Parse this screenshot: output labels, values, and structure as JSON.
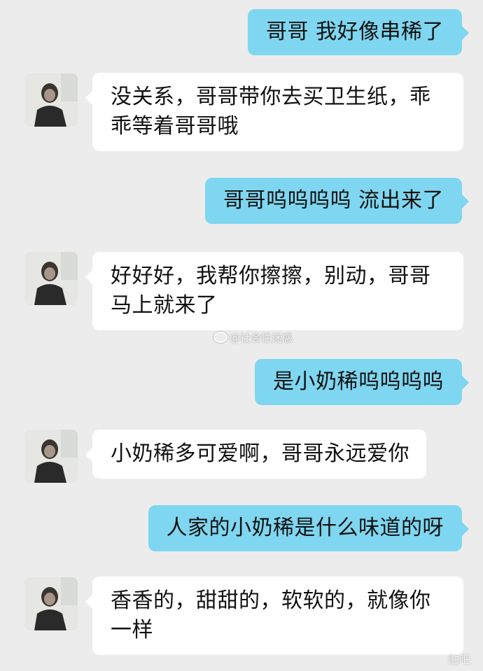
{
  "messages": [
    {
      "side": "sent",
      "text": "哥哥 我好像串稀了"
    },
    {
      "side": "received",
      "lines": [
        "没关系，哥哥带你去买卫生纸，乖",
        "乖等着哥哥哦"
      ]
    },
    {
      "side": "sent",
      "text": "哥哥呜呜呜呜 流出来了"
    },
    {
      "side": "received",
      "lines": [
        "好好好，我帮你擦擦，别动，哥哥",
        "马上就来了"
      ]
    },
    {
      "side": "sent",
      "text": "是小奶稀呜呜呜呜"
    },
    {
      "side": "received",
      "lines": [
        "小奶稀多可爱啊，哥哥永远爱你"
      ]
    },
    {
      "side": "sent",
      "text": "人家的小奶稀是什么味道的呀"
    },
    {
      "side": "received",
      "lines": [
        "香香的，甜甜的，软软的，就像你",
        "一样"
      ]
    }
  ],
  "watermark": "@社会性迷惑",
  "corner_mark": "贴吧",
  "colors": {
    "background": "#ececec",
    "sent_bubble": "#7fd6f0",
    "received_bubble": "#ffffff"
  },
  "icons": {
    "avatar": "user-photo-avatar",
    "watermark_logo": "weibo-logo-icon"
  }
}
